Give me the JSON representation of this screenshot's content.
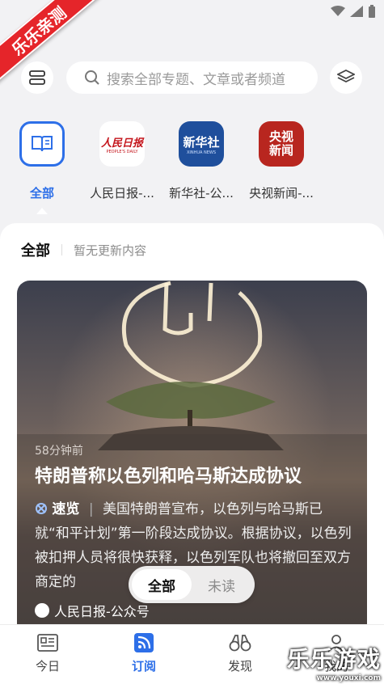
{
  "watermark_ribbon": "乐乐亲测",
  "search": {
    "placeholder": "搜索全部专题、文章或者频道"
  },
  "channels": [
    {
      "label": "全部",
      "active": true,
      "icon": "book-icon"
    },
    {
      "label": "人民日报-...",
      "logo_text": "人民日报",
      "logo_sub": "PEOPLE'S DAILY"
    },
    {
      "label": "新华社-公...",
      "logo_text": "新华社",
      "logo_sub": "XINHUA NEWS"
    },
    {
      "label": "央视新闻-...",
      "logo_text": "央视\n新闻"
    }
  ],
  "panel": {
    "title": "全部",
    "subtitle": "暂无更新内容"
  },
  "article": {
    "time": "58分钟前",
    "title": "特朗普称以色列和哈马斯达成协议",
    "tag": "速览",
    "summary": "美国特朗普宣布，以色列与哈马斯已就“和平计划”第一阶段达成协议。根据协议，以色列被扣押人员将很快获释，以色列军队也将撤回至双方商定的",
    "source": "人民日报-公众号"
  },
  "toggle": {
    "all": "全部",
    "unread": "未读"
  },
  "tabs": [
    {
      "label": "今日"
    },
    {
      "label": "订阅",
      "active": true
    },
    {
      "label": "发现"
    },
    {
      "label": "我的"
    }
  ],
  "corner_watermark": {
    "text": "乐乐游戏",
    "url": "www.youxi.com"
  },
  "colors": {
    "accent": "#2d6fe8",
    "ribbon": "#e5252a",
    "xinhua": "#1f4f9c",
    "cctv": "#b8261f"
  }
}
